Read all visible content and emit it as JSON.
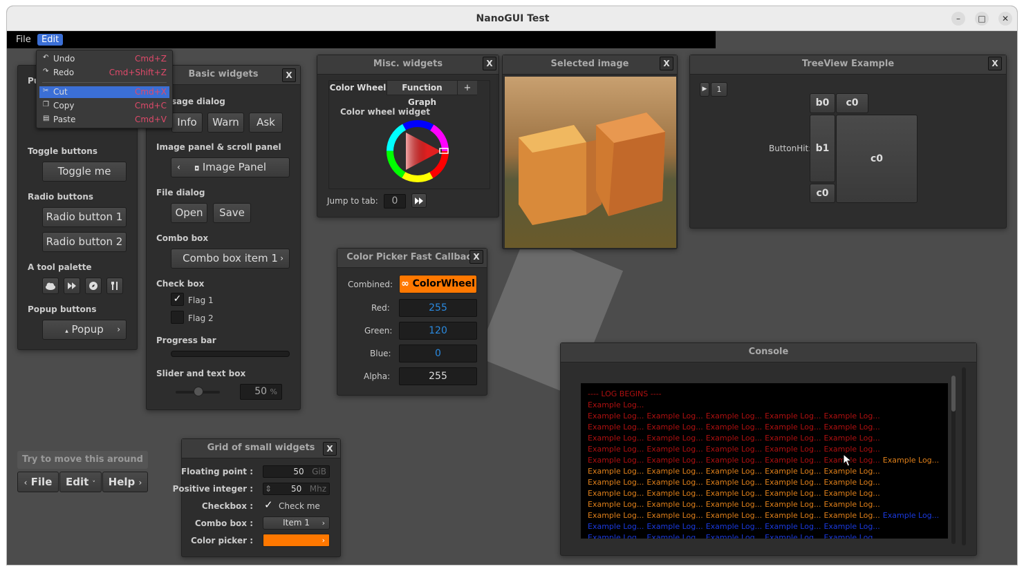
{
  "window": {
    "title": "NanoGUI Test",
    "minimize": "–",
    "maximize": "□",
    "close": "✕"
  },
  "menubar": {
    "file": "File",
    "edit": "Edit"
  },
  "edit_menu": [
    {
      "icon": "undo-icon",
      "glyph": "↶",
      "label": "Undo",
      "shortcut": "Cmd+Z"
    },
    {
      "icon": "redo-icon",
      "glyph": "↷",
      "label": "Redo",
      "shortcut": "Cmd+Shift+Z"
    },
    {
      "icon": "scissors-icon",
      "glyph": "✂",
      "label": "Cut",
      "shortcut": "Cmd+X",
      "selected": true
    },
    {
      "icon": "copy-icon",
      "glyph": "❐",
      "label": "Copy",
      "shortcut": "Cmd+C"
    },
    {
      "icon": "paste-icon",
      "glyph": "▤",
      "label": "Paste",
      "shortcut": "Cmd+V"
    }
  ],
  "button_demo": {
    "partial_label": "Pu",
    "toggle_header": "Toggle buttons",
    "toggle_btn": "Toggle me",
    "radio_header": "Radio buttons",
    "radio1": "Radio button 1",
    "radio2": "Radio button 2",
    "palette_header": "A tool palette",
    "popup_header": "Popup buttons",
    "popup_btn": "Popup",
    "popup_chevron": "›",
    "palette_icons": [
      "cloud-icon",
      "fast-forward-icon",
      "compass-icon",
      "utensils-icon"
    ]
  },
  "basic": {
    "title": "Basic widgets",
    "close": "X",
    "msg_header": "sage dialog",
    "info": "Info",
    "warn": "Warn",
    "ask": "Ask",
    "img_header": "Image panel & scroll panel",
    "img_btn": "Image Panel",
    "img_chevron": "‹",
    "file_header": "File dialog",
    "open": "Open",
    "save": "Save",
    "combo_header": "Combo box",
    "combo_btn": "Combo box item 1",
    "combo_chevron": "›",
    "check_header": "Check box",
    "flag1": "Flag 1",
    "flag2": "Flag 2",
    "checkmark": "✓",
    "progress_header": "Progress bar",
    "progress": 0,
    "slider_header": "Slider and text box",
    "slider_value": "50",
    "slider_unit": "%",
    "slider_fraction": 0.5
  },
  "misc": {
    "title": "Misc. widgets",
    "close": "X",
    "tab1": "Color Wheel",
    "tab2": "Function Graph",
    "tab_add": "+",
    "wheel_label": "Color wheel widget",
    "jump_label": "Jump to tab:",
    "jump_value": "0",
    "jump_icon": "fast-forward-icon"
  },
  "selected_image": {
    "title": "Selected image",
    "close": "X"
  },
  "treeview": {
    "title": "TreeView Example",
    "close": "X",
    "play_glyph": "▶",
    "count": "1",
    "hit_label": "ButtonHit:",
    "b0": "b0",
    "c0_top": "c0",
    "b1": "b1",
    "c0_mid": "c0",
    "c0_bot": "c0"
  },
  "colorpicker": {
    "title": "Color Picker Fast Callback",
    "close": "X",
    "combined_label": "Combined:",
    "combined_btn": "ColorWheel",
    "combined_icon": "infinity-icon",
    "red_label": "Red:",
    "red": "255",
    "green_label": "Green:",
    "green": "120",
    "blue_label": "Blue:",
    "blue": "0",
    "alpha_label": "Alpha:",
    "alpha": "255",
    "accent": "#ff7800"
  },
  "console": {
    "title": "Console",
    "begin": "---- LOG BEGINS ----",
    "entry": "Example Log...",
    "colors": {
      "red": "#b01010",
      "orange": "#e0801a",
      "blue": "#1a3ae0"
    }
  },
  "move": {
    "title": "Try to move this around",
    "file": "File",
    "edit": "Edit",
    "help": "Help",
    "left_chevron": "‹",
    "down_chevron": "˅",
    "right_chevron": "›"
  },
  "grid": {
    "title": "Grid of small widgets",
    "close": "X",
    "float_label": "Floating point :",
    "float_value": "50",
    "float_unit": "GiB",
    "int_label": "Positive integer :",
    "int_value": "50",
    "int_unit": "Mhz",
    "int_spin": "⇕",
    "check_label": "Checkbox :",
    "check_text": "Check me",
    "checkmark": "✓",
    "combo_label": "Combo box :",
    "combo_value": "Item 1",
    "combo_chevron": "›",
    "color_label": "Color picker :",
    "color_chevron": "›",
    "color_value": "#ff7800"
  }
}
